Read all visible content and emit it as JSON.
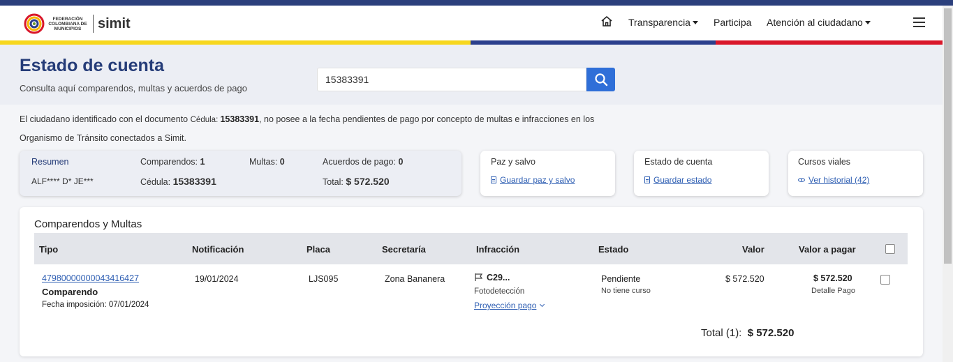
{
  "nav": {
    "logo_federacion": "FEDERACIÓN COLOMBIANA DE MUNICIPIOS",
    "logo_simit": "simit",
    "transparencia": "Transparencia",
    "participa": "Participa",
    "atencion": "Atención al ciudadano"
  },
  "header": {
    "title": "Estado de cuenta",
    "subtitle": "Consulta aquí comparendos, multas y acuerdos de pago",
    "search_value": "15383391"
  },
  "info": {
    "part1": "El ciudadano identificado con el documento ",
    "doc_type": "Cédula",
    "colon": ": ",
    "doc_number": "15383391",
    "part2": ", no posee a la fecha pendientes de pago por concepto de multas e infracciones en los",
    "part3": "Organismo de Tránsito conectados a Simit."
  },
  "summary": {
    "label": "Resumen",
    "name": "ALF**** D* JE***",
    "comparendos_label": "Comparendos:",
    "comparendos_value": "1",
    "multas_label": "Multas:",
    "multas_value": "0",
    "acuerdos_label": "Acuerdos de pago:",
    "acuerdos_value": "0",
    "cedula_label": "Cédula:",
    "cedula_value": "15383391",
    "total_label": "Total:",
    "total_value": "$ 572.520"
  },
  "cards": {
    "paz_title": "Paz y salvo",
    "paz_link": "Guardar paz y salvo",
    "estado_title": "Estado de cuenta",
    "estado_link": "Guardar estado",
    "cursos_title": "Cursos viales",
    "cursos_link": "Ver historial (42)"
  },
  "table": {
    "title": "Comparendos y Multas",
    "headers": {
      "tipo": "Tipo",
      "notificacion": "Notificación",
      "placa": "Placa",
      "secretaria": "Secretaría",
      "infraccion": "Infracción",
      "estado": "Estado",
      "valor": "Valor",
      "valor_pagar": "Valor a pagar"
    },
    "rows": [
      {
        "numero": "47980000000043416427",
        "tipo": "Comparendo",
        "fecha_imposicion": "Fecha imposición: 07/01/2024",
        "notificacion": "19/01/2024",
        "placa": "LJS095",
        "secretaria": "Zona Bananera",
        "infraccion_code": "C29...",
        "infraccion_tipo": "Fotodetección",
        "proyeccion": "Proyección pago",
        "estado": "Pendiente",
        "curso": "No tiene curso",
        "valor": "$ 572.520",
        "valor_pagar": "$ 572.520",
        "detalle": "Detalle Pago"
      }
    ],
    "total_label": "Total (1):",
    "total_value": "$ 572.520"
  },
  "colors": {
    "brand_blue": "#253c78",
    "button_blue": "#2f6fd8",
    "stripe_yellow": "#f7d71e",
    "stripe_blue": "#2b3f8c",
    "stripe_red": "#d9172a"
  }
}
